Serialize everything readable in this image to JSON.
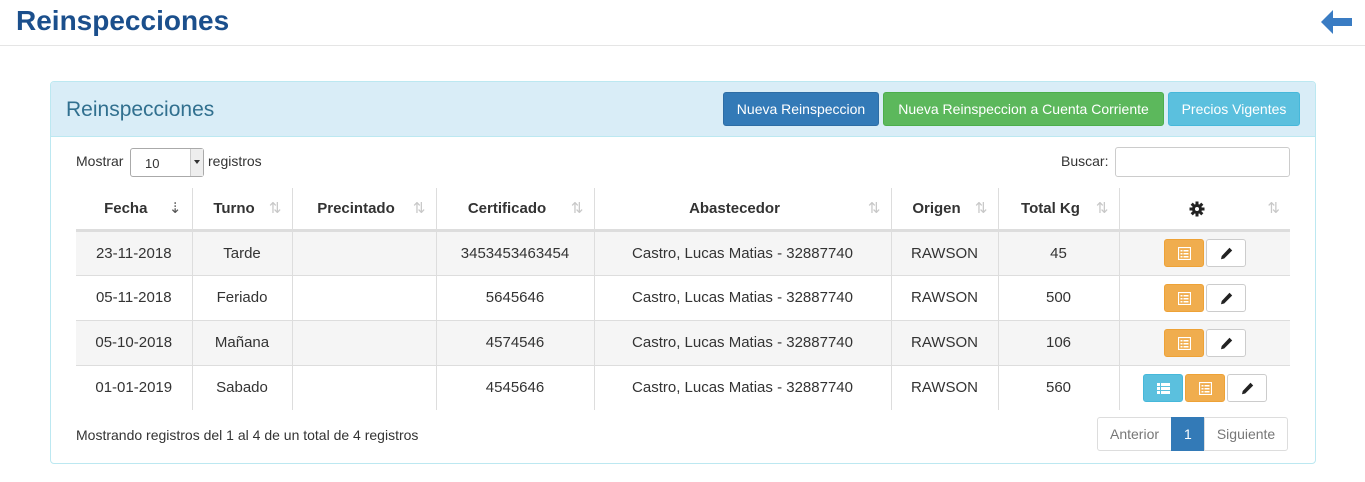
{
  "header": {
    "title": "Reinspecciones",
    "back_icon": "arrow-left-icon"
  },
  "panel": {
    "title": "Reinspecciones",
    "buttons": {
      "nueva": "Nueva Reinspeccion",
      "cuenta_corriente": "Nueva Reinspeccion a Cuenta Corriente",
      "precios": "Precios Vigentes"
    }
  },
  "controls": {
    "show_label": "Mostrar",
    "show_value": "10",
    "records_label": "registros",
    "search_label": "Buscar:",
    "search_value": ""
  },
  "table": {
    "columns": [
      "Fecha",
      "Turno",
      "Precintado",
      "Certificado",
      "Abastecedor",
      "Origen",
      "Total Kg",
      "gear-icon"
    ],
    "rows": [
      {
        "fecha": "23-11-2018",
        "turno": "Tarde",
        "precintado": "",
        "certificado": "3453453463454",
        "abastecedor": "Castro, Lucas Matias - 32887740",
        "origen": "RAWSON",
        "total": "45",
        "actions": [
          "list-alt-icon",
          "pencil-icon"
        ]
      },
      {
        "fecha": "05-11-2018",
        "turno": "Feriado",
        "precintado": "",
        "certificado": "5645646",
        "abastecedor": "Castro, Lucas Matias - 32887740",
        "origen": "RAWSON",
        "total": "500",
        "actions": [
          "list-alt-icon",
          "pencil-icon"
        ]
      },
      {
        "fecha": "05-10-2018",
        "turno": "Mañana",
        "precintado": "",
        "certificado": "4574546",
        "abastecedor": "Castro, Lucas Matias - 32887740",
        "origen": "RAWSON",
        "total": "106",
        "actions": [
          "list-alt-icon",
          "pencil-icon"
        ]
      },
      {
        "fecha": "01-01-2019",
        "turno": "Sabado",
        "precintado": "",
        "certificado": "4545646",
        "abastecedor": "Castro, Lucas Matias - 32887740",
        "origen": "RAWSON",
        "total": "560",
        "actions": [
          "list-icon",
          "list-alt-icon",
          "pencil-icon"
        ]
      }
    ]
  },
  "footer": {
    "info": "Mostrando registros del 1 al 4 de un total de 4 registros",
    "prev": "Anterior",
    "page": "1",
    "next": "Siguiente"
  },
  "colors": {
    "title": "#1b4f8c",
    "primary": "#337ab7",
    "success": "#5cb85c",
    "info": "#5bc0de",
    "warning": "#f0ad4e"
  }
}
